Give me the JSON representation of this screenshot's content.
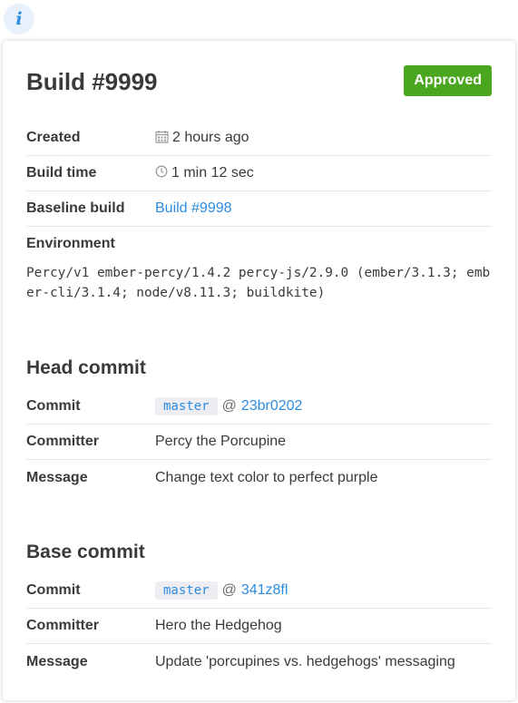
{
  "info_button": {
    "glyph": "i"
  },
  "build": {
    "title": "Build #9999",
    "status": "Approved",
    "created_label": "Created",
    "created_value": "2 hours ago",
    "build_time_label": "Build time",
    "build_time_value": "1 min 12 sec",
    "baseline_label": "Baseline build",
    "baseline_value": "Build #9998",
    "environment_label": "Environment",
    "environment_value": "Percy/v1 ember-percy/1.4.2 percy-js/2.9.0 (ember/3.1.3; ember-cli/3.1.4; node/v8.11.3; buildkite)"
  },
  "head_commit": {
    "title": "Head commit",
    "commit_label": "Commit",
    "branch": "master",
    "at": "@",
    "sha": "23br0202",
    "committer_label": "Committer",
    "committer": "Percy the Porcupine",
    "message_label": "Message",
    "message": "Change text color to perfect purple"
  },
  "base_commit": {
    "title": "Base commit",
    "commit_label": "Commit",
    "branch": "master",
    "at": "@",
    "sha": "341z8fl",
    "committer_label": "Committer",
    "committer": "Hero the Hedgehog",
    "message_label": "Message",
    "message": "Update 'porcupines vs. hedgehogs' messaging"
  },
  "icons": {
    "created": "calendar-icon",
    "build_time": "clock-icon",
    "info": "info-icon"
  },
  "colors": {
    "approved": "#4aa61e",
    "link": "#2d8be0"
  }
}
